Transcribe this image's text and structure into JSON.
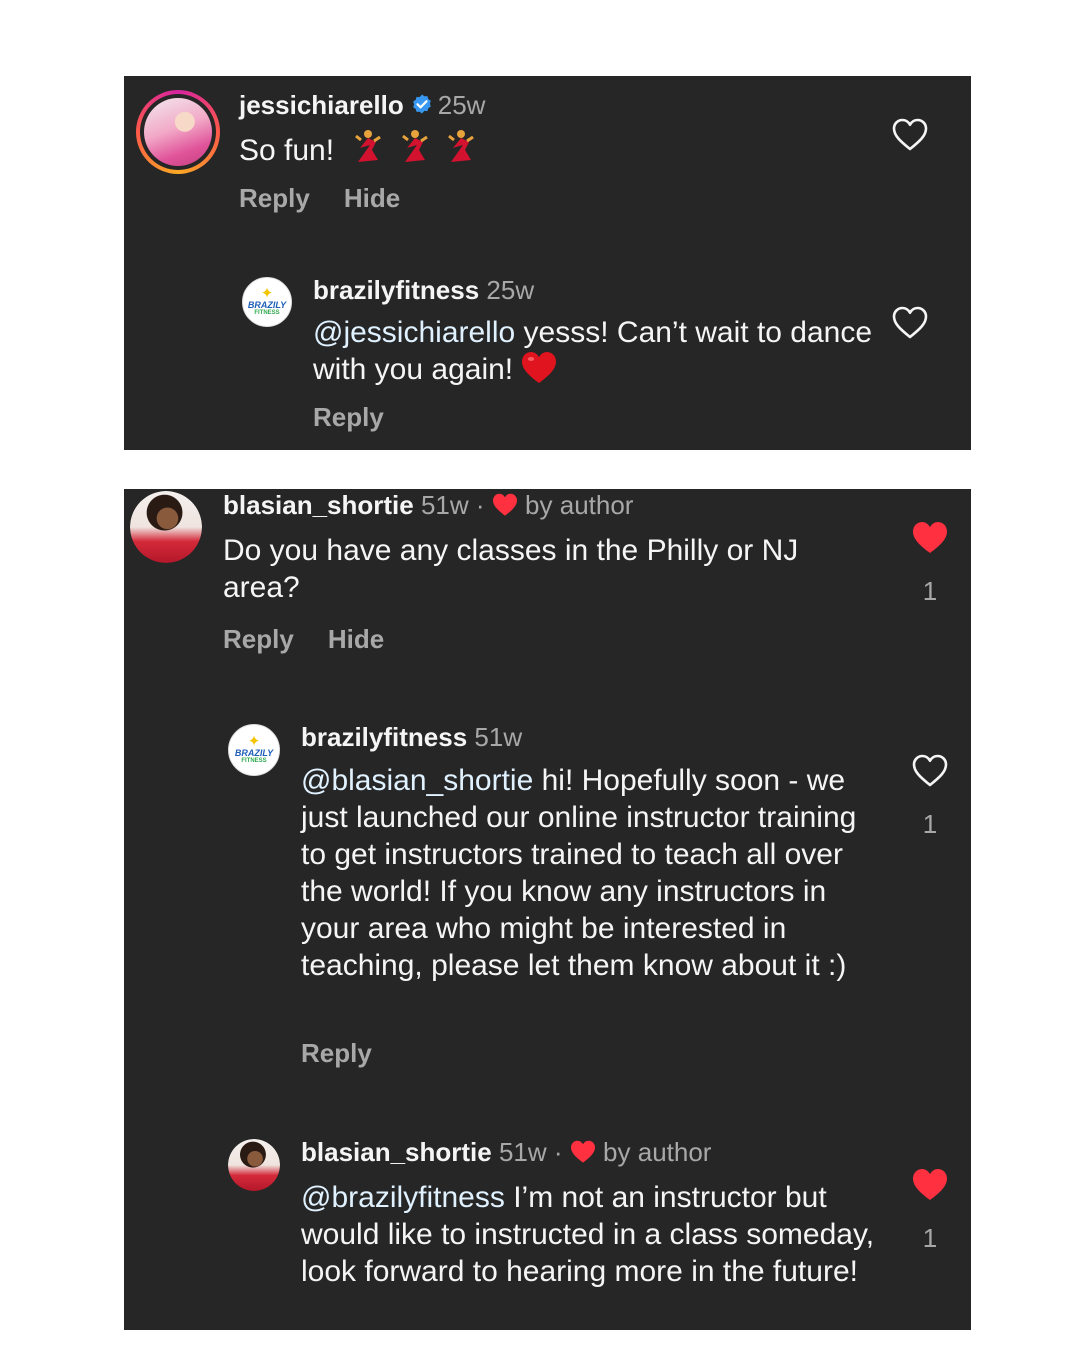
{
  "thread1": {
    "comment": {
      "username": "jessichiarello",
      "verified_icon": "verified-badge-icon",
      "time": "25w",
      "text": "So fun!",
      "emojis": "dancer-emoji x3",
      "actions": {
        "reply": "Reply",
        "hide": "Hide"
      },
      "like_icon": "heart-outline-icon"
    },
    "reply": {
      "username": "brazilyfitness",
      "time": "25w",
      "mention": "@jessichiarello",
      "text": "yesss! Can’t wait to dance with you again!",
      "emoji": "red-heart-emoji",
      "actions": {
        "reply": "Reply"
      },
      "like_icon": "heart-outline-icon"
    }
  },
  "thread2": {
    "comment": {
      "username": "blasian_shortie",
      "time": "51w",
      "separator": "·",
      "author_label": "by author",
      "text": "Do you have any classes in the Philly or NJ area?",
      "actions": {
        "reply": "Reply",
        "hide": "Hide"
      },
      "likes": "1",
      "like_icon": "heart-filled-icon"
    },
    "reply1": {
      "username": "brazilyfitness",
      "time": "51w",
      "mention": "@blasian_shortie",
      "text": "hi! Hopefully soon - we just launched our online instructor training to get instructors trained to teach all over the world! If you know any instructors in your area who might be interested in teaching, please let them know about it :)",
      "actions": {
        "reply": "Reply"
      },
      "likes": "1",
      "like_icon": "heart-outline-icon"
    },
    "reply2": {
      "username": "blasian_shortie",
      "time": "51w",
      "separator": "·",
      "author_label": "by author",
      "mention": "@brazilyfitness",
      "text": "I’m not an instructor but would like to instructed in a class someday, look forward to hearing more in the future!",
      "likes": "1",
      "like_icon": "heart-filled-icon"
    }
  },
  "logo": {
    "word": "BRAZILY",
    "sub": "FITNESS"
  },
  "colors": {
    "panel_bg": "#262626",
    "text": "#f5f5f5",
    "muted": "#a8a8a8",
    "mention": "#e0f1ff",
    "like_red": "#ff3040",
    "verified_blue": "#3897f0"
  }
}
